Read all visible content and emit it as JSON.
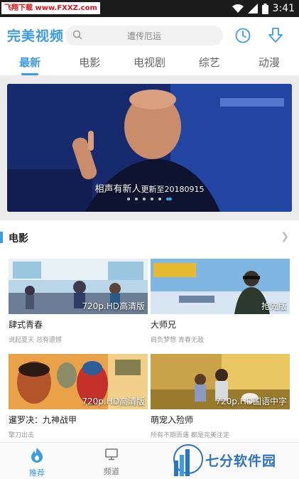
{
  "status_bar": {
    "watermark": "飞翔下载 www.FXXZ.com",
    "time": "3:41"
  },
  "header": {
    "logo": "完美视频",
    "search_placeholder": "遭传厄运",
    "icons": [
      "search-icon",
      "history-clock-icon",
      "download-icon"
    ]
  },
  "tabs": [
    {
      "label": "最新",
      "active": true
    },
    {
      "label": "电影",
      "active": false
    },
    {
      "label": "电视剧",
      "active": false
    },
    {
      "label": "综艺",
      "active": false
    },
    {
      "label": "动漫",
      "active": false
    }
  ],
  "banner": {
    "title": "相声有新人",
    "update": "更新至20180915",
    "dot_count": 6,
    "active_dot": 6
  },
  "section": {
    "title": "电影"
  },
  "cards": [
    {
      "title": "肆式青春",
      "subtitle": "说起夏天 总有遗憾",
      "badge": "720p.HD高清版"
    },
    {
      "title": "大师兄",
      "subtitle": "肩负梦想 青春无敌",
      "badge": "抢先版"
    },
    {
      "title": "暹罗决：九神战甲",
      "subtitle": "擎刀出击",
      "badge": "720p.HD高清版"
    },
    {
      "title": "萌宠入殓师",
      "subtitle": "所有不期而遇 都是完美注定",
      "badge": "720p.HD国语中字"
    }
  ],
  "bottom_nav": {
    "home": "推荐",
    "channel": "频道"
  },
  "site_watermark": "七分软件园",
  "colors": {
    "accent": "#3b9be3",
    "status_bar": "#1c1c1c",
    "watermark_red": "#e0141a"
  }
}
